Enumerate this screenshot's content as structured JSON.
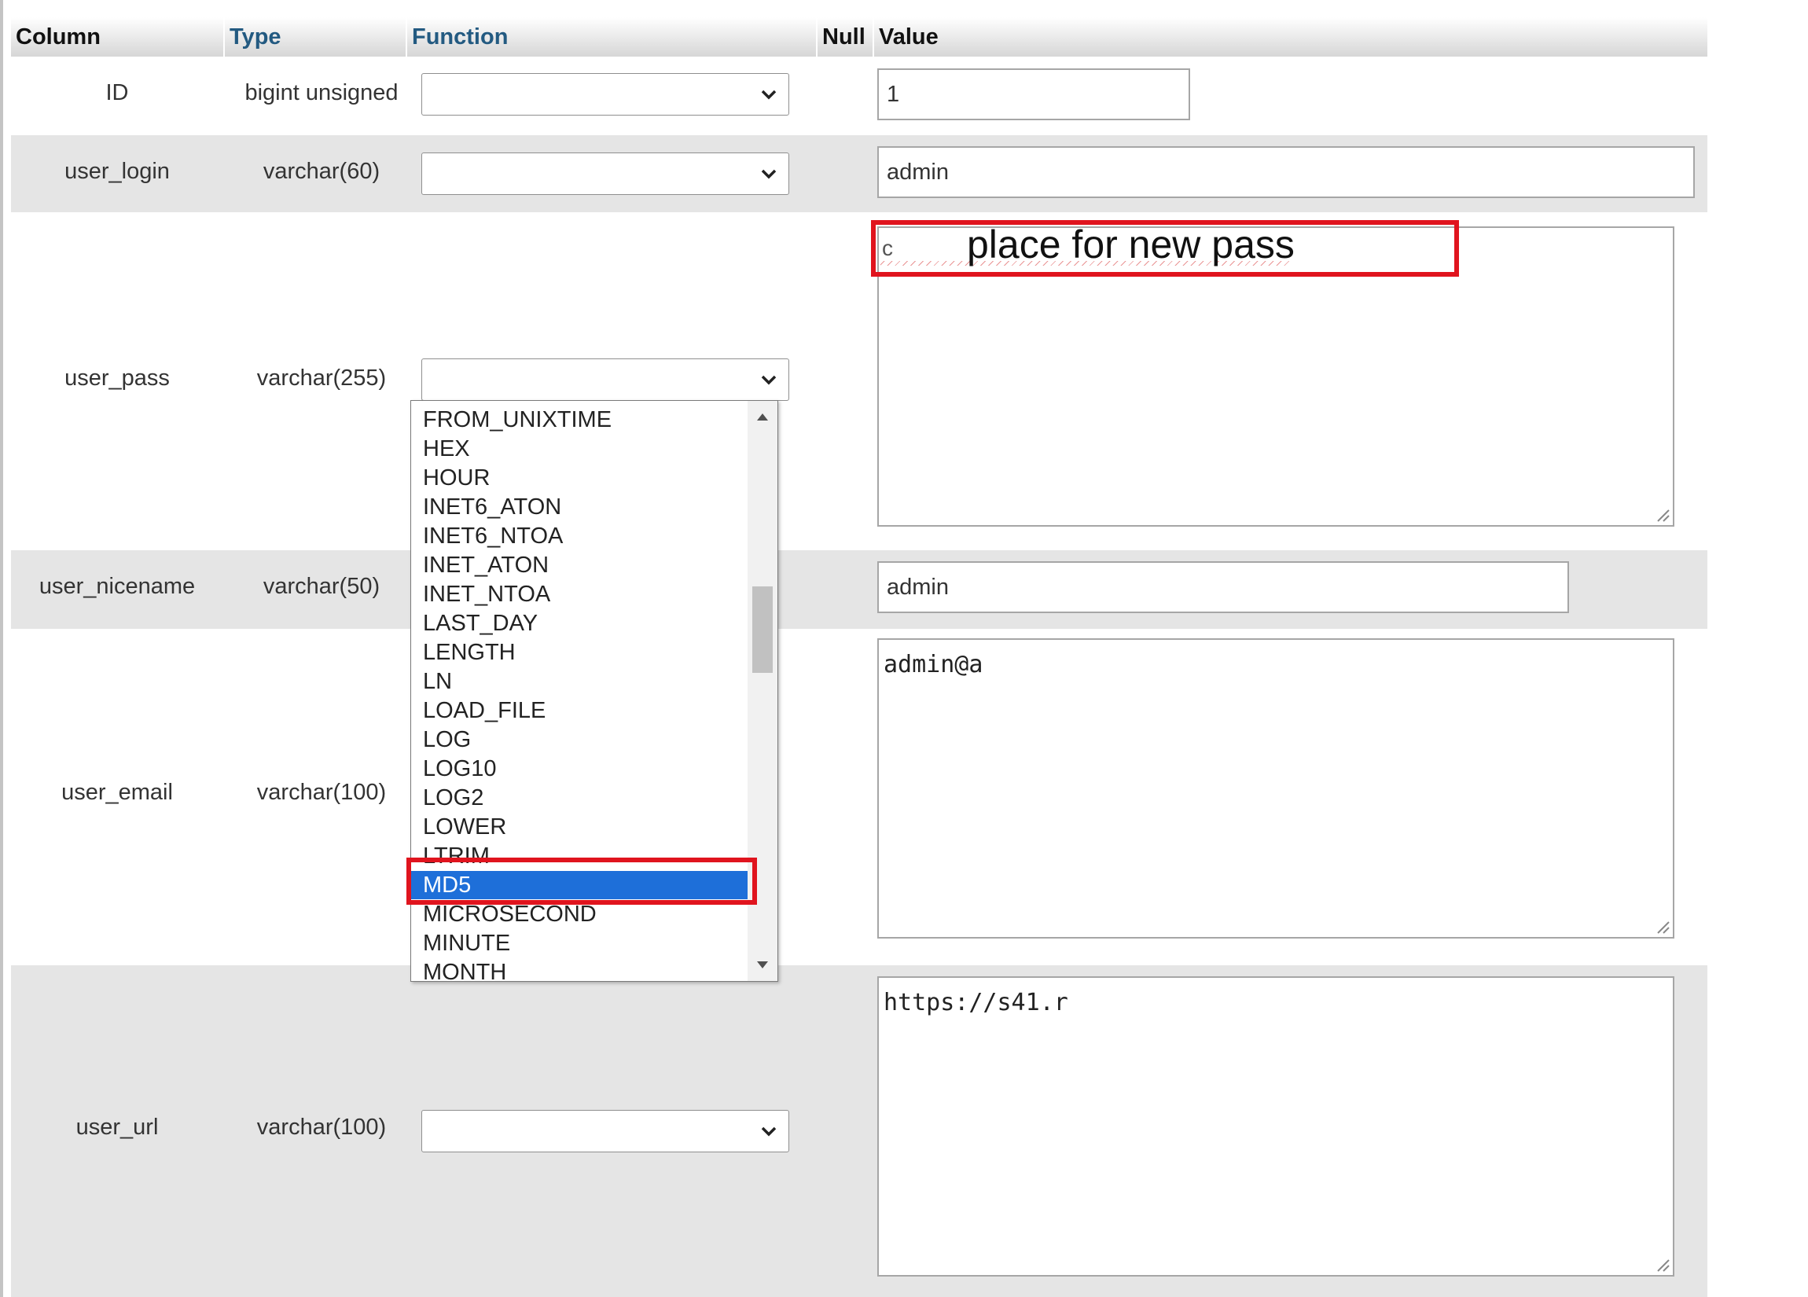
{
  "header": {
    "column": "Column",
    "type": "Type",
    "function": "Function",
    "null": "Null",
    "value": "Value"
  },
  "rows": [
    {
      "column": "ID",
      "type": "bigint unsigned",
      "value": "1"
    },
    {
      "column": "user_login",
      "type": "varchar(60)",
      "value": "admin"
    },
    {
      "column": "user_pass",
      "type": "varchar(255)",
      "value": "c"
    },
    {
      "column": "user_nicename",
      "type": "varchar(50)",
      "value": "admin"
    },
    {
      "column": "user_email",
      "type": "varchar(100)",
      "value": "admin@a"
    },
    {
      "column": "user_url",
      "type": "varchar(100)",
      "value": "https://s41.r"
    }
  ],
  "function_dropdown": {
    "options": [
      "FROM_UNIXTIME",
      "HEX",
      "HOUR",
      "INET6_ATON",
      "INET6_NTOA",
      "INET_ATON",
      "INET_NTOA",
      "LAST_DAY",
      "LENGTH",
      "LN",
      "LOAD_FILE",
      "LOG",
      "LOG10",
      "LOG2",
      "LOWER",
      "LTRIM",
      "MD5",
      "MICROSECOND",
      "MINUTE",
      "MONTH"
    ],
    "selected": "MD5",
    "selected_color": "#1e6fd9"
  },
  "annotation": {
    "text": "place for new pass",
    "color": "#e0141e"
  }
}
